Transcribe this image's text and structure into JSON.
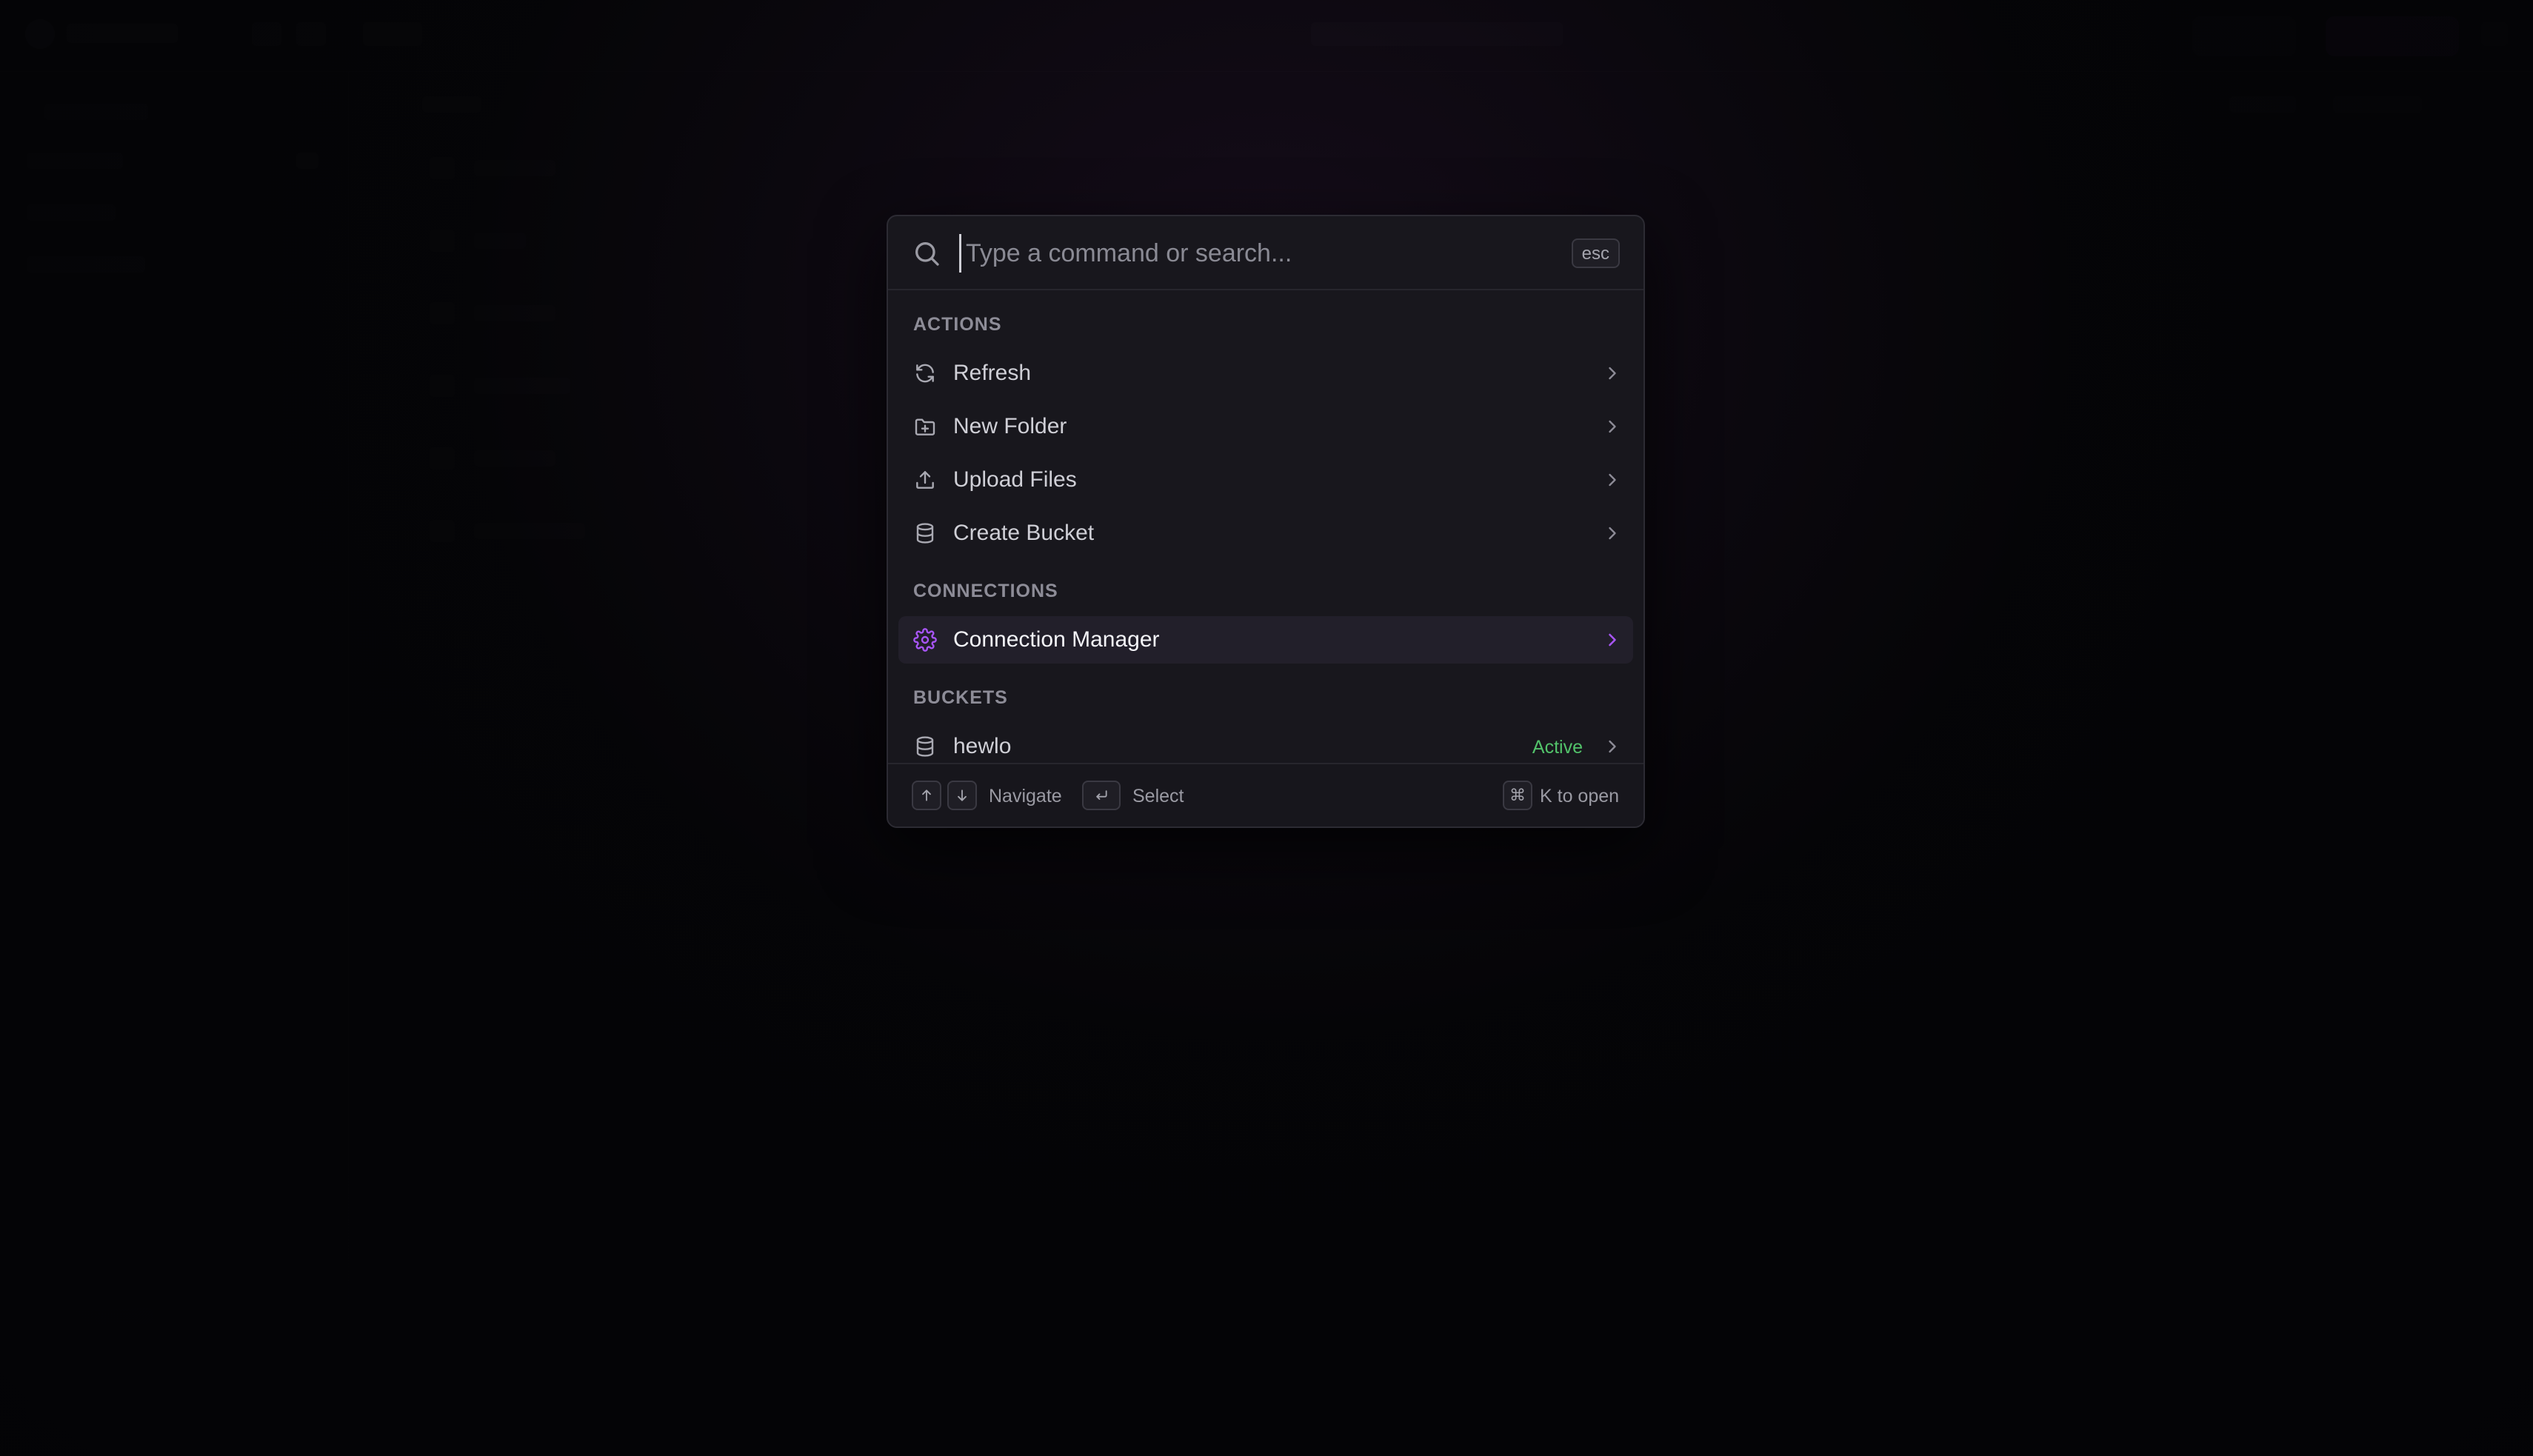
{
  "palette": {
    "search": {
      "placeholder": "Type a command or search...",
      "value": "",
      "esc_label": "esc"
    },
    "groups": [
      {
        "label": "ACTIONS",
        "items": [
          {
            "label": "Refresh",
            "icon": "refresh-icon"
          },
          {
            "label": "New Folder",
            "icon": "folder-plus-icon"
          },
          {
            "label": "Upload Files",
            "icon": "upload-icon"
          },
          {
            "label": "Create Bucket",
            "icon": "database-icon"
          }
        ]
      },
      {
        "label": "CONNECTIONS",
        "items": [
          {
            "label": "Connection Manager",
            "icon": "gear-icon",
            "selected": true
          }
        ]
      },
      {
        "label": "BUCKETS",
        "items": [
          {
            "label": "hewlo",
            "icon": "database-icon",
            "badge": "Active"
          }
        ]
      }
    ],
    "footer": {
      "navigate_label": "Navigate",
      "select_label": "Select",
      "open_key": "⌘",
      "open_label": "K to open"
    }
  },
  "colors": {
    "panel_bg": "#18171d",
    "accent": "#a855f7",
    "active_badge": "#52c26a",
    "selected_bg": "#221f2a"
  }
}
